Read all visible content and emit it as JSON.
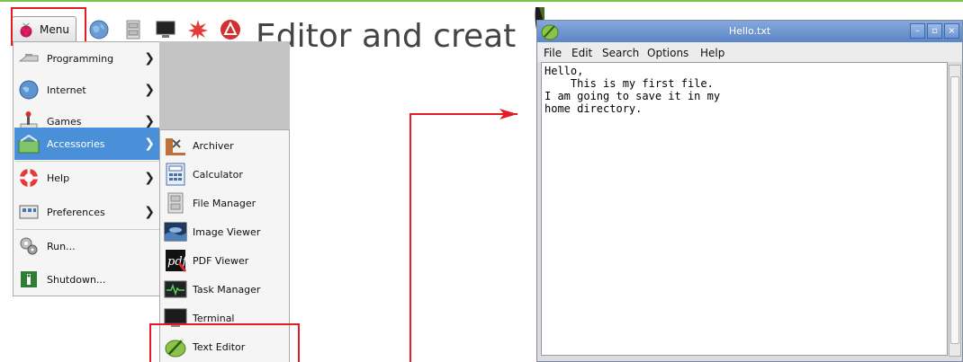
{
  "taskbar": {
    "menu_label": "Menu",
    "icons": [
      "raspberry-icon",
      "web-browser-icon",
      "file-manager-icon",
      "terminal-icon",
      "wolfram-icon",
      "mathematica-icon"
    ]
  },
  "background_text": "Editor and create",
  "main_menu": {
    "items": [
      {
        "label": "Programming",
        "icon": "programming-icon",
        "has_submenu": true
      },
      {
        "label": "Internet",
        "icon": "internet-icon",
        "has_submenu": true
      },
      {
        "label": "Games",
        "icon": "games-icon",
        "has_submenu": true
      },
      {
        "label": "Accessories",
        "icon": "accessories-icon",
        "has_submenu": true,
        "active": true
      },
      {
        "label": "Help",
        "icon": "help-icon",
        "has_submenu": true
      },
      {
        "label": "Preferences",
        "icon": "preferences-icon",
        "has_submenu": true
      },
      {
        "label": "Run...",
        "icon": "run-icon",
        "has_submenu": false
      },
      {
        "label": "Shutdown...",
        "icon": "shutdown-icon",
        "has_submenu": false
      }
    ]
  },
  "accessories_menu": {
    "items": [
      {
        "label": "Archiver",
        "icon": "archiver-icon"
      },
      {
        "label": "Calculator",
        "icon": "calculator-icon"
      },
      {
        "label": "File Manager",
        "icon": "file-manager-icon"
      },
      {
        "label": "Image Viewer",
        "icon": "image-viewer-icon"
      },
      {
        "label": "PDF Viewer",
        "icon": "pdf-viewer-icon"
      },
      {
        "label": "Task Manager",
        "icon": "task-manager-icon"
      },
      {
        "label": "Terminal",
        "icon": "terminal-icon"
      },
      {
        "label": "Text Editor",
        "icon": "text-editor-icon",
        "highlighted": true
      }
    ]
  },
  "editor": {
    "title": "Hello.txt",
    "menu": [
      "File",
      "Edit",
      "Search",
      "Options",
      "Help"
    ],
    "content": "Hello,\n    This is my first file.\nI am going to save it in my\nhome directory."
  },
  "colors": {
    "highlight_box": "#e31b23",
    "menu_active": "#4a90d9",
    "titlebar": "#6a92cf",
    "top_rule": "#77c34c"
  }
}
